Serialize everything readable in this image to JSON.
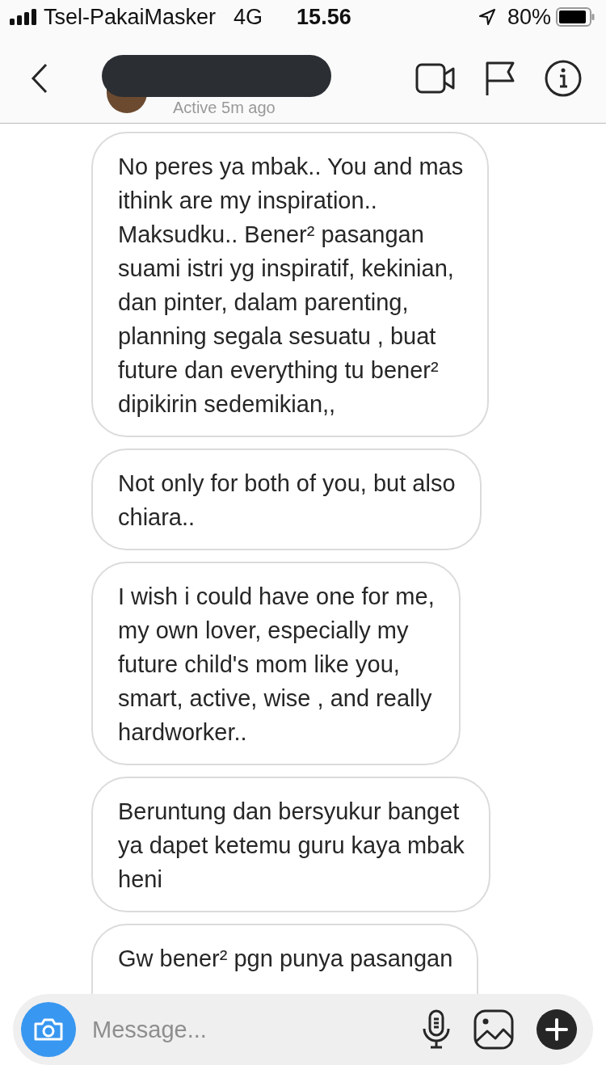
{
  "status_bar": {
    "carrier": "Tsel-PakaiMasker",
    "network": "4G",
    "time": "15.56",
    "battery": "80%"
  },
  "header": {
    "status": "Active 5m ago"
  },
  "messages": [
    {
      "lines": [
        "No peres ya mbak.. You and mas",
        "ithink are my inspiration..",
        "Maksudku.. Bener² pasangan",
        "suami istri yg inspiratif, kekinian,",
        "dan pinter, dalam parenting,",
        "planning segala sesuatu , buat",
        "future dan everything tu  bener²",
        "dipikirin sedemikian,,"
      ]
    },
    {
      "lines": [
        "Not only for both of you, but also",
        "chiara.."
      ]
    },
    {
      "lines": [
        "I wish i could have one for me,",
        "my own lover, especially my",
        "future child's mom like you,",
        "smart, active, wise , and really",
        "hardworker.."
      ]
    },
    {
      "lines": [
        "Beruntung dan bersyukur banget",
        "ya dapet ketemu guru kaya mbak",
        "heni"
      ]
    },
    {
      "lines": [
        "Gw bener² pgn punya pasangan"
      ]
    }
  ],
  "composer": {
    "placeholder": "Message..."
  }
}
